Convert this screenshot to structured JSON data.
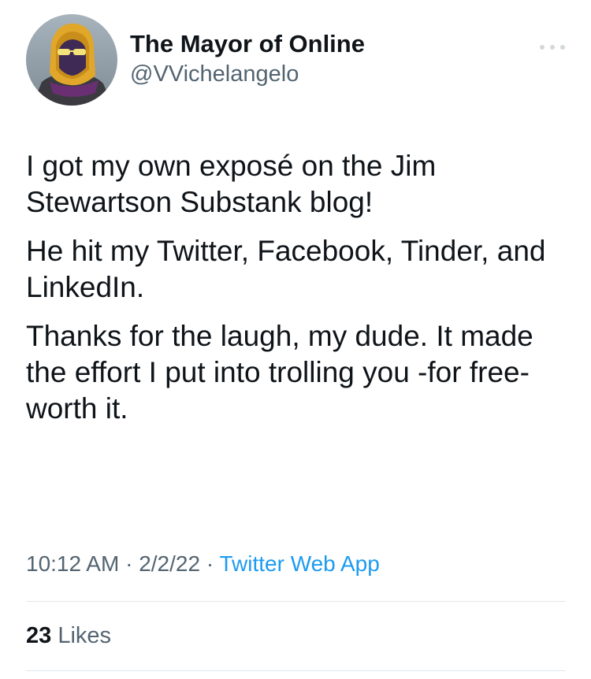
{
  "author": {
    "display_name": "The Mayor of Online",
    "handle": "@VVichelangelo",
    "avatar_icon": "avatar-hooded-figure-icon"
  },
  "more_icon": "more-dots-icon",
  "tweet": {
    "paragraphs": [
      "I got my own exposé on the Jim Stewartson Substank blog!",
      "He hit my Twitter, Facebook, Tinder, and LinkedIn.",
      "Thanks for the laugh, my dude. It made the effort I put into trolling you -for free- worth it."
    ]
  },
  "meta": {
    "time": "10:12 AM",
    "date": "2/2/22",
    "separator": "·",
    "source": "Twitter Web App"
  },
  "stats": {
    "likes_count": "23",
    "likes_label": "Likes"
  },
  "colors": {
    "text": "#0f1419",
    "secondary": "#536471",
    "link": "#1d9bf0",
    "divider": "#e3e8ec"
  }
}
